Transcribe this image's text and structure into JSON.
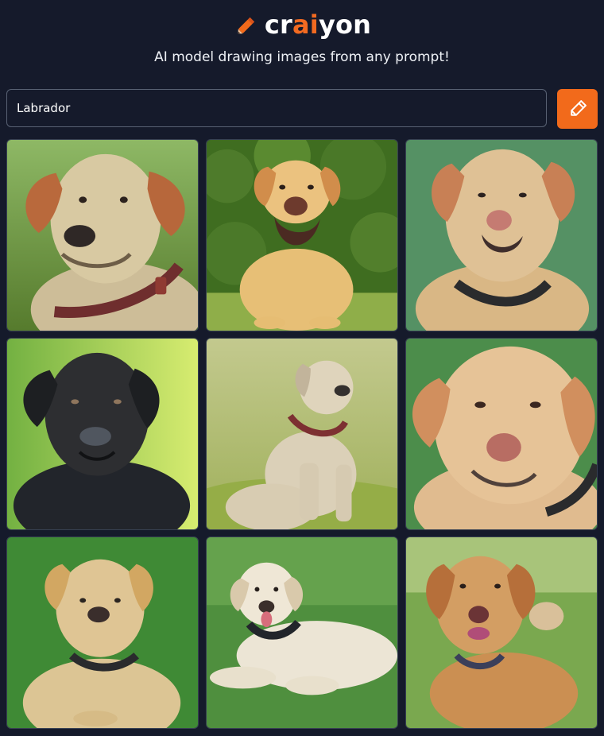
{
  "app": {
    "logo_text_start": "cr",
    "logo_text_accent": "ai",
    "logo_text_end": "yon",
    "tagline": "AI model drawing images from any prompt!",
    "accent_color": "#f26a1b",
    "background_color": "#151a2b",
    "logo_icon": "pencil-icon"
  },
  "prompt": {
    "value": "Labrador",
    "placeholder": ""
  },
  "draw_button": {
    "icon": "pencil-icon",
    "aria_label": "Draw"
  },
  "results": [
    {
      "subject": "yellow-labrador-closeup",
      "coat": "#d8c9a2"
    },
    {
      "subject": "yellow-labrador-sitting-hedge",
      "coat": "#e7bf76"
    },
    {
      "subject": "yellow-labrador-portrait",
      "coat": "#d9b785"
    },
    {
      "subject": "black-labrador-portrait",
      "coat": "#26272a"
    },
    {
      "subject": "yellow-labrador-sitting-field",
      "coat": "#dbd0b8"
    },
    {
      "subject": "yellow-labrador-closeup-2",
      "coat": "#e6c397"
    },
    {
      "subject": "yellow-labrador-lying",
      "coat": "#dfc594"
    },
    {
      "subject": "white-labrador-lying",
      "coat": "#ece5d5"
    },
    {
      "subject": "golden-labrador-lying",
      "coat": "#cb8f52"
    }
  ]
}
